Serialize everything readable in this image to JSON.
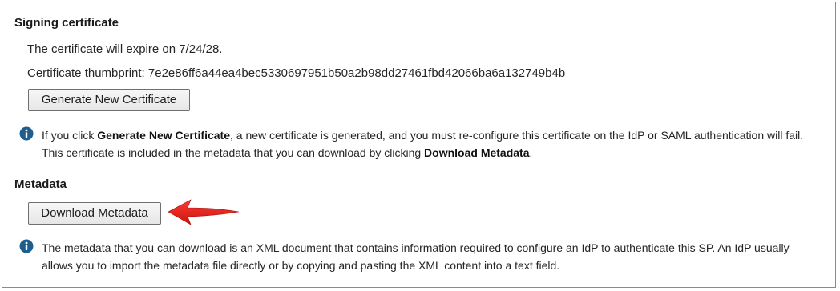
{
  "signing": {
    "title": "Signing certificate",
    "expiry_text": "The certificate will expire on 7/24/28.",
    "thumbprint_label": "Certificate thumbprint: ",
    "thumbprint_value": "7e2e86ff6a44ea4bec5330697951b50a2b98dd27461fbd42066ba6a132749b4b",
    "generate_button": "Generate New Certificate",
    "note": {
      "part1": "If you click ",
      "bold1": "Generate New Certificate",
      "part2": ", a new certificate is generated, and you must re-configure this certificate on the IdP or SAML authentication will fail. This certificate is included in the metadata that you can download by clicking ",
      "bold2": "Download Metadata",
      "part3": "."
    }
  },
  "metadata": {
    "title": "Metadata",
    "download_button": "Download Metadata",
    "note": "The metadata that you can download is an XML document that contains information required to configure an IdP to authenticate this SP. An IdP usually allows you to import the metadata file directly or by copying and pasting the XML content into a text field."
  },
  "icons": {
    "info": "info-circle-icon",
    "arrow": "red-arrow-pointer-icon"
  },
  "colors": {
    "info_icon": "#1f5e8c",
    "arrow": "#e0201c"
  }
}
